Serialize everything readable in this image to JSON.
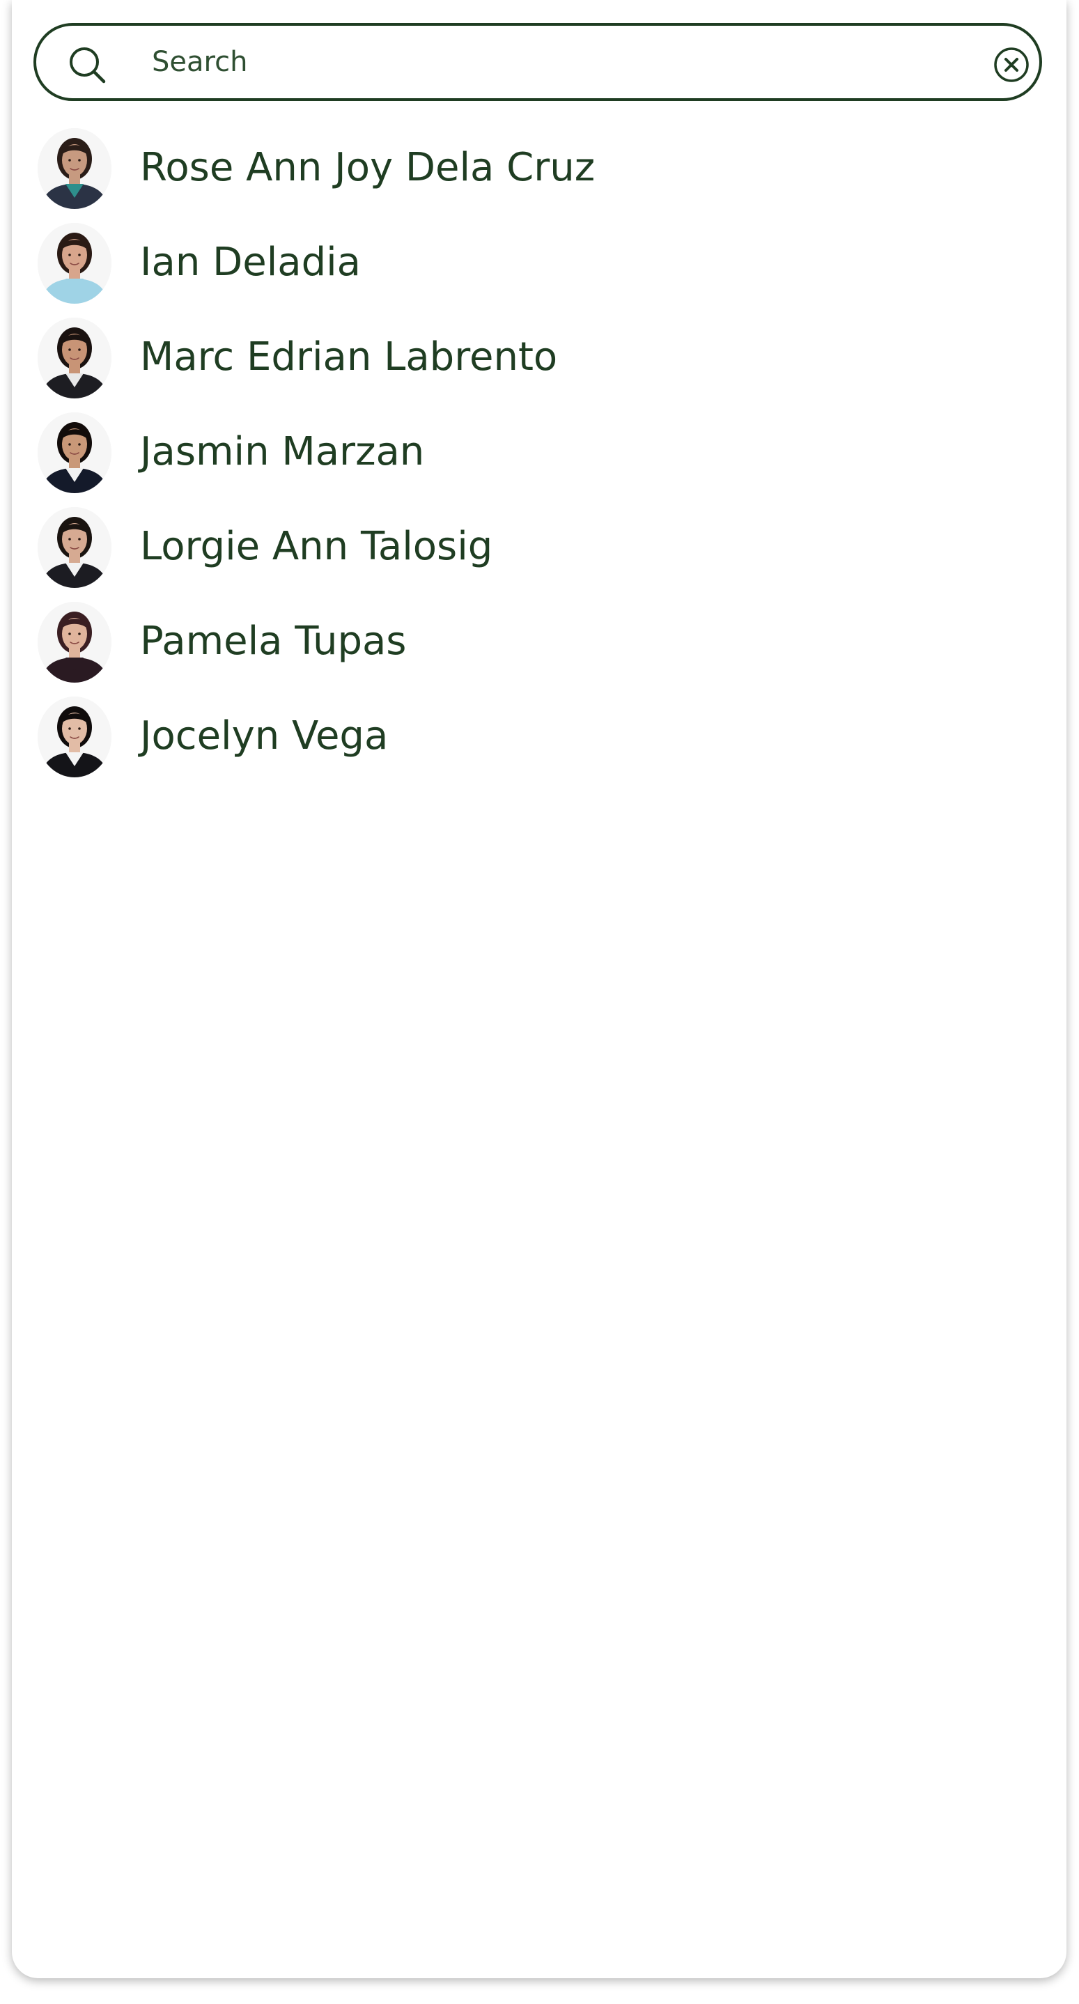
{
  "search": {
    "placeholder": "Search",
    "value": "",
    "search_icon": "search-icon",
    "clear_icon": "close-circle-icon"
  },
  "colors": {
    "accent": "#1f3d22",
    "background": "#ffffff"
  },
  "people": [
    {
      "name": "Rose Ann Joy Dela Cruz",
      "avatar": "avatar-photo",
      "hair": "#2a1d18",
      "shirt": "#2e8f8c",
      "suit": "#2b3345",
      "skin": "#c79a80"
    },
    {
      "name": "Ian Deladia",
      "avatar": "avatar-photo",
      "hair": "#2a1a14",
      "shirt": "#9fd3e6",
      "suit": "#9fd3e6",
      "skin": "#d8a58c"
    },
    {
      "name": "Marc Edrian Labrento",
      "avatar": "avatar-photo",
      "hair": "#1a1210",
      "shirt": "#e8e8e8",
      "suit": "#1d1d22",
      "skin": "#c89476"
    },
    {
      "name": "Jasmin Marzan",
      "avatar": "avatar-photo",
      "hair": "#120c0a",
      "shirt": "#f2f2f2",
      "suit": "#141a2a",
      "skin": "#c99878"
    },
    {
      "name": "Lorgie Ann Talosig",
      "avatar": "avatar-photo",
      "hair": "#1a1410",
      "shirt": "#f2f2f2",
      "suit": "#1c1c22",
      "skin": "#d6aa92"
    },
    {
      "name": "Pamela Tupas",
      "avatar": "avatar-photo",
      "hair": "#3a1e22",
      "shirt": "#2a1a22",
      "suit": "#2a1a22",
      "skin": "#e0b49c"
    },
    {
      "name": "Jocelyn Vega",
      "avatar": "avatar-photo",
      "hair": "#100c0c",
      "shirt": "#f4f4f4",
      "suit": "#141418",
      "skin": "#e2bca6"
    }
  ]
}
